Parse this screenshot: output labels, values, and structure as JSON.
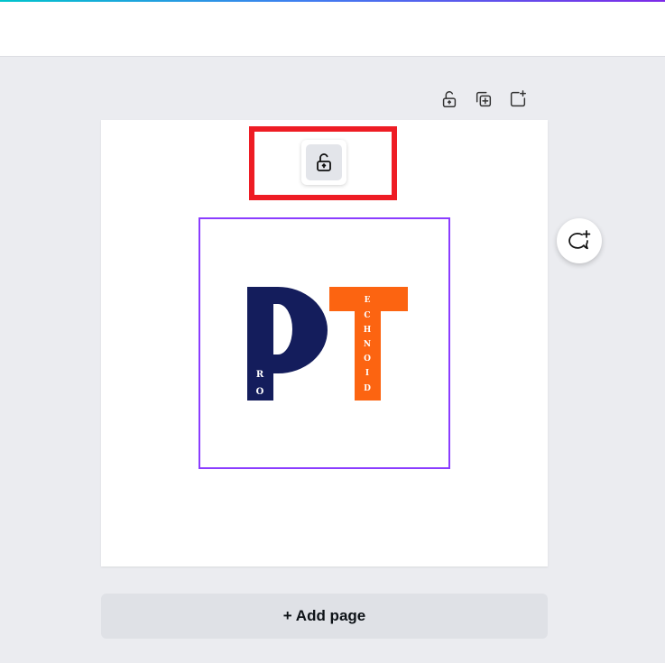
{
  "page": {
    "add_page_label": "+ Add page"
  },
  "logo": {
    "letter_p": "P",
    "letter_t": "T",
    "p_small_letters": [
      "R",
      "O"
    ],
    "t_small_letters": [
      "E",
      "C",
      "H",
      "N",
      "O",
      "I",
      "D"
    ],
    "colors": {
      "p_color": "#141d5c",
      "t_color": "#fc6411",
      "small_letter_color": "#ffffff"
    }
  },
  "colors": {
    "selection": "#8b3dff",
    "highlight": "#ee1c24",
    "canvas_bg": "#ffffff",
    "workspace_bg": "#ebecf0"
  },
  "icons": {
    "page_tools": [
      "unlock-icon",
      "duplicate-page-icon",
      "add-page-icon"
    ],
    "lock_popup": "unlock-icon",
    "comment": "add-comment-icon"
  }
}
